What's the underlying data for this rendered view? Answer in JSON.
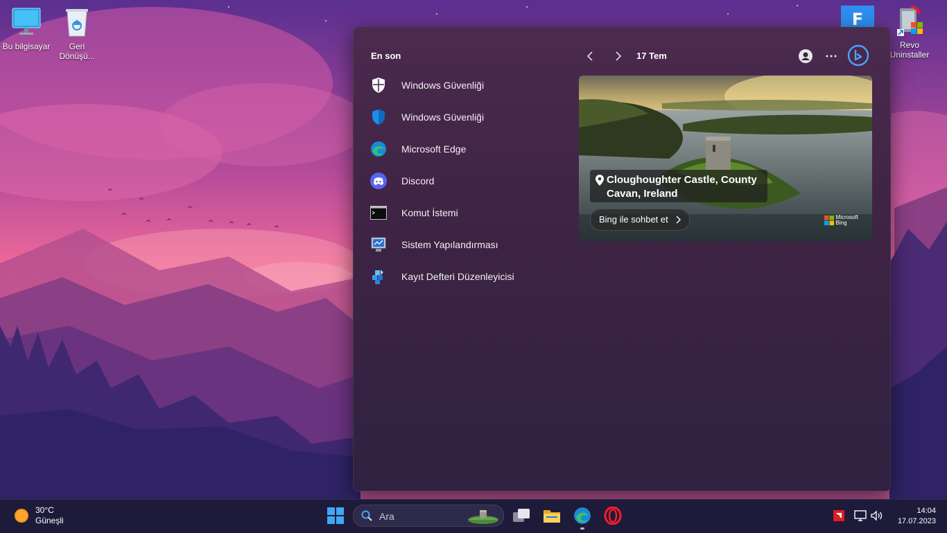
{
  "desktop": {
    "icons": [
      {
        "label": "Bu bilgisayar",
        "icon": "monitor-icon"
      },
      {
        "label": "Geri Dönüşü...",
        "icon": "recycle-bin-icon"
      },
      {
        "label": "Revo Uninstaller",
        "icon": "revo-uninstaller-icon"
      },
      {
        "label": "",
        "icon": "fortnite-icon"
      }
    ]
  },
  "widgets": {
    "section_title": "En son",
    "date": "17 Tem",
    "recent": [
      {
        "label": "Windows Güvenliği",
        "icon": "shield-white-icon"
      },
      {
        "label": "Windows Güvenliği",
        "icon": "shield-blue-icon"
      },
      {
        "label": "Microsoft Edge",
        "icon": "edge-icon"
      },
      {
        "label": "Discord",
        "icon": "discord-icon"
      },
      {
        "label": "Komut İstemi",
        "icon": "terminal-icon"
      },
      {
        "label": "Sistem Yapılandırması",
        "icon": "system-config-icon"
      },
      {
        "label": "Kayıt Defteri Düzenleyicisi",
        "icon": "registry-icon"
      }
    ],
    "picture": {
      "location": "Cloughoughter Castle, County Cavan, Ireland",
      "chat_button": "Bing ile sohbet et",
      "brand_line1": "Microsoft",
      "brand_line2": "Bing"
    }
  },
  "taskbar": {
    "weather_temp": "30°C",
    "weather_desc": "Güneşli",
    "search_placeholder": "Ara",
    "time": "14:04",
    "date": "17.07.2023"
  },
  "colors": {
    "accent_blue": "#4aa3ff",
    "opera_red": "#ff1b2d",
    "panel_bg": "#3d2344"
  }
}
